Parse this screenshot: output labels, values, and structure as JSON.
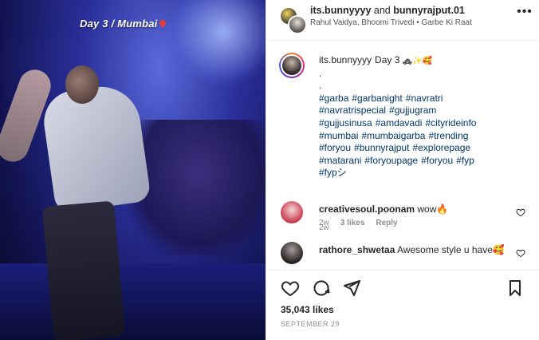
{
  "media": {
    "caption": "Day 3 / Mumbai",
    "pin_icon": "location-pin-icon"
  },
  "header": {
    "user1": "its.bunnyyyy",
    "and": "and",
    "user2": "bunnyrajput.01",
    "subtitle": "Rahul Vaidya, Bhoomi Trivedi • Garbe Ki Raat",
    "more_icon": "more-icon"
  },
  "post": {
    "username": "its.bunnyyyy",
    "caption_start": "Day 3",
    "emojis": [
      "🚓",
      "✨",
      "🥰"
    ],
    "dots": [
      ".",
      "."
    ],
    "hashtags": [
      "#garba",
      "#garbanight",
      "#navratri",
      "#navratrispecial",
      "#gujjugram",
      "#gujjusinusa",
      "#amdavadi",
      "#cityrideinfo",
      "#mumbai",
      "#mumbaigarba",
      "#trending",
      "#foryou",
      "#bunnyrajput",
      "#explorepage",
      "#matarani",
      "#foryoupage",
      "#foryou",
      "#fyp",
      "#fypシ"
    ],
    "time": "2w"
  },
  "comments": [
    {
      "username": "creativesoul.poonam",
      "text": "wow🔥",
      "time": "2w",
      "likes": "3 likes",
      "reply": "Reply"
    },
    {
      "username": "rathore_shwetaa",
      "text": "Awesome style u have🥰"
    }
  ],
  "actions": {
    "like_icon": "heart-icon",
    "comment_icon": "comment-icon",
    "share_icon": "share-icon",
    "save_icon": "bookmark-icon"
  },
  "likes_count": "35,043 likes",
  "date": "SEPTEMBER 29"
}
